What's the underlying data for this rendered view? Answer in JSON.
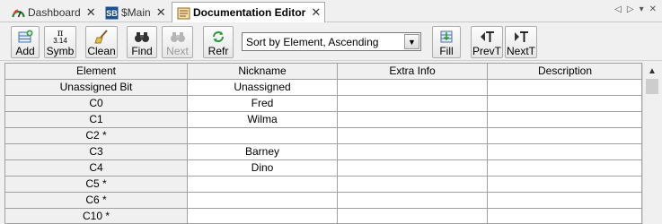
{
  "tabs": [
    {
      "label": "Dashboard",
      "icon": "dashboard-icon",
      "active": false
    },
    {
      "label": "$Main",
      "icon": "ladder-program-icon",
      "active": false
    },
    {
      "label": "Documentation Editor",
      "icon": "documentation-editor-icon",
      "active": true
    }
  ],
  "toolbar": {
    "add_label": "Add",
    "symb_label": "Symb",
    "clean_label": "Clean",
    "find_label": "Find",
    "next_label": "Next",
    "refr_label": "Refr",
    "sort_value": "Sort by Element, Ascending",
    "fill_label": "Fill",
    "prevt_label": "PrevT",
    "nextt_label": "NextT",
    "symb_icon_text": "3.14"
  },
  "grid": {
    "columns": [
      "Element",
      "Nickname",
      "Extra Info",
      "Description"
    ],
    "rows": [
      {
        "element": "Unassigned Bit",
        "nickname": "Unassigned",
        "extra": "",
        "description": ""
      },
      {
        "element": "C0",
        "nickname": "Fred",
        "extra": "",
        "description": ""
      },
      {
        "element": "C1",
        "nickname": "Wilma",
        "extra": "",
        "description": ""
      },
      {
        "element": "C2 *",
        "nickname": "",
        "extra": "",
        "description": ""
      },
      {
        "element": "C3",
        "nickname": "Barney",
        "extra": "",
        "description": ""
      },
      {
        "element": "C4",
        "nickname": "Dino",
        "extra": "",
        "description": ""
      },
      {
        "element": "C5 *",
        "nickname": "",
        "extra": "",
        "description": ""
      },
      {
        "element": "C6 *",
        "nickname": "",
        "extra": "",
        "description": ""
      },
      {
        "element": "C10 *",
        "nickname": "",
        "extra": "",
        "description": ""
      }
    ]
  },
  "colors": {
    "accent_blue": "#1c5fb8",
    "header_bg": "#f0f0f0",
    "grid_line": "#a0a0a0"
  }
}
